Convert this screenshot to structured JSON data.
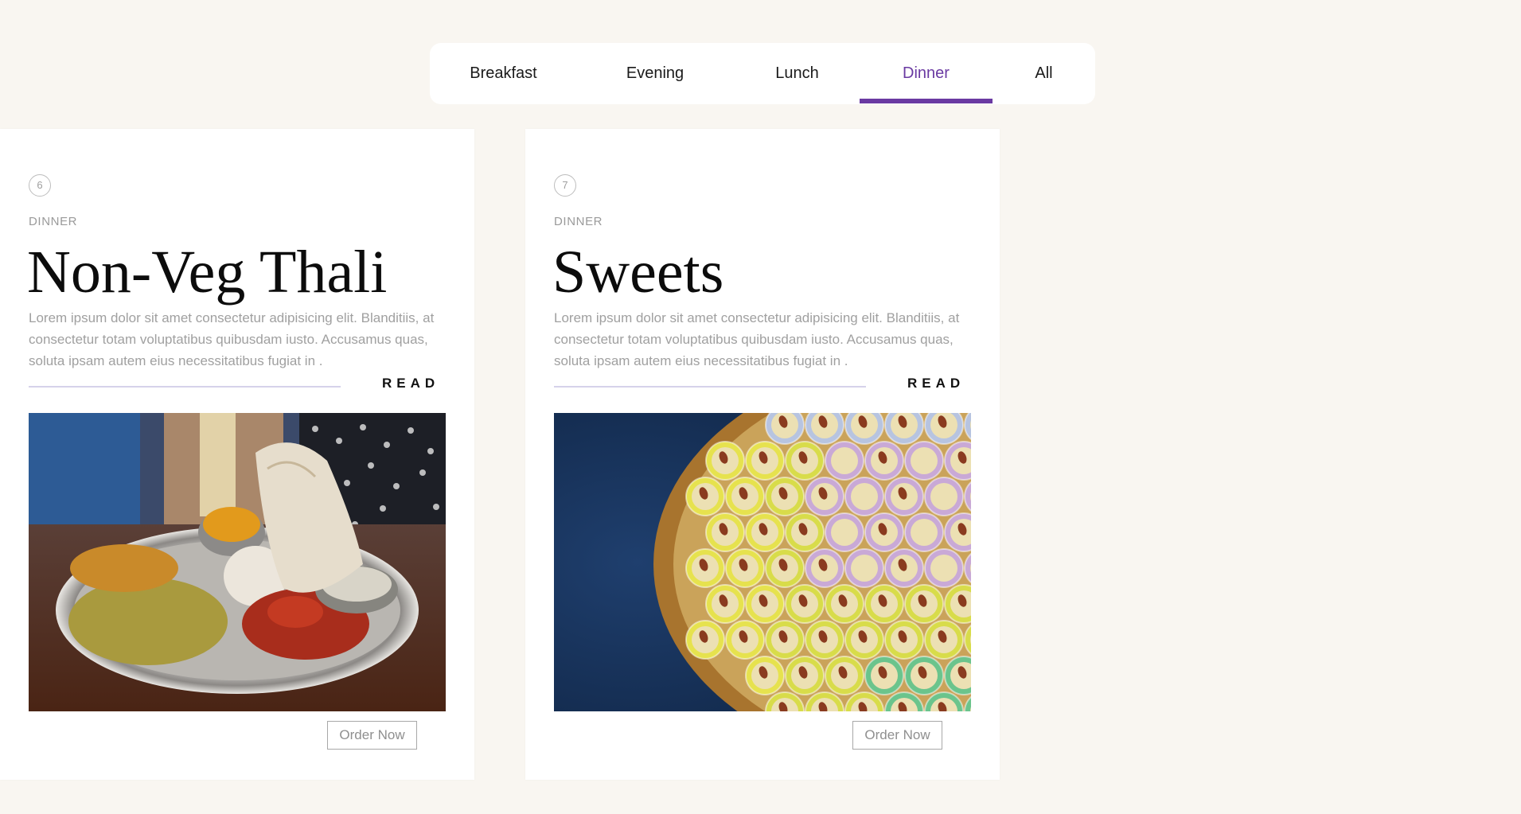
{
  "tabs": [
    {
      "label": "Breakfast"
    },
    {
      "label": "Evening"
    },
    {
      "label": "Lunch"
    },
    {
      "label": "Dinner",
      "active": true
    },
    {
      "label": "All"
    }
  ],
  "accent_color": "#6a3aa2",
  "cards": [
    {
      "number": "6",
      "category": "DINNER",
      "title": "Non-Veg Thali",
      "description": "Lorem ipsum dolor sit amet consectetur adipisicing elit. Blanditiis, at consectetur totam voluptatibus quibusdam iusto. Accusamus quas, soluta ipsam autem eius necessitatibus fugiat in .",
      "read_label": "READ",
      "image": "non-veg-thali-photo",
      "order_label": "Order Now"
    },
    {
      "number": "7",
      "category": "DINNER",
      "title": "Sweets",
      "description": "Lorem ipsum dolor sit amet consectetur adipisicing elit. Blanditiis, at consectetur totam voluptatibus quibusdam iusto. Accusamus quas, soluta ipsam autem eius necessitatibus fugiat in .",
      "read_label": "READ",
      "image": "sweets-photo",
      "order_label": "Order Now"
    }
  ]
}
